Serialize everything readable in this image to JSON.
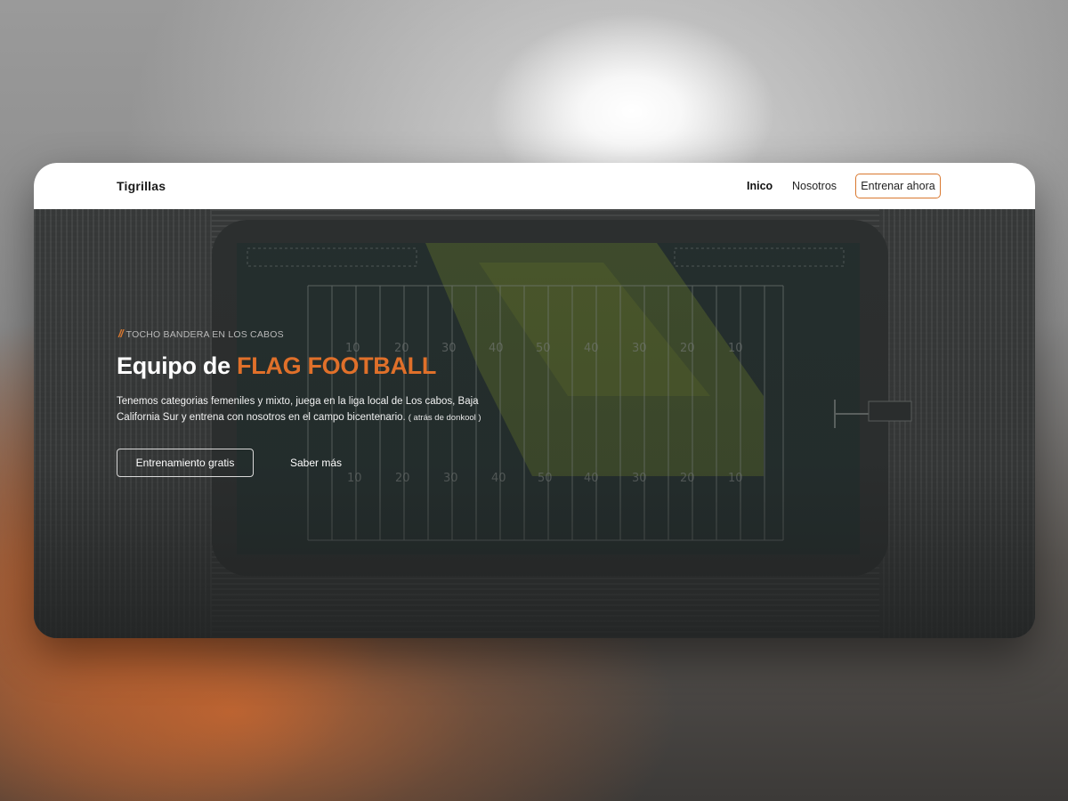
{
  "navbar": {
    "brand": "Tigrillas",
    "links": [
      {
        "label": "Inico",
        "active": true
      },
      {
        "label": "Nosotros",
        "active": false
      }
    ],
    "cta_label": "Entrenar ahora"
  },
  "hero": {
    "eyebrow_mark": "//",
    "eyebrow": "TOCHO BANDERA EN LOS CABOS",
    "headline_prefix": "Equipo de ",
    "headline_accent": "FLAG FOOTBALL",
    "description": "Tenemos categorias femeniles y mixto, juega en la liga local de Los cabos, Baja California Sur y entrena con nosotros en el campo bicentenario.",
    "description_note": "( atrás de donkool )",
    "primary_button": "Entrenamiento gratis",
    "secondary_button": "Saber más",
    "field_yard_numbers_top": [
      "10",
      "20",
      "30",
      "40",
      "50",
      "40",
      "30",
      "20",
      "10"
    ],
    "field_yard_numbers_bottom": [
      "10",
      "20",
      "30",
      "40",
      "50",
      "40",
      "30",
      "20",
      "10"
    ]
  },
  "colors": {
    "accent": "#e0702a",
    "cta_border": "#d9782f",
    "hero_bg": "#2b2e2e",
    "navbar_bg": "#ffffff"
  }
}
